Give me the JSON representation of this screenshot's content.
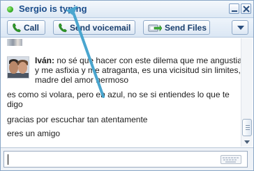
{
  "window": {
    "title": "Sergio is typing",
    "status_color": "#2aa51b",
    "minimize_icon": "minimize-icon",
    "close_icon": "close-icon"
  },
  "toolbar": {
    "call_label": "Call",
    "voicemail_label": "Send voicemail",
    "sendfiles_label": "Send Files",
    "call_icon": "phone-icon",
    "voicemail_icon": "phone-icon",
    "sendfiles_icon": "file-transfer-icon",
    "more_icon": "chevron-down-icon"
  },
  "chat": {
    "messages": [
      {
        "sender": "Iván:",
        "text": "no sé que hacer con este dilema que me angustia y me asfixia y me atraganta, es una vicisitud sin limites, madre del amor hermoso"
      },
      {
        "sender": "",
        "text": "es como si volara, pero en azul, no se si entiendes lo que te digo"
      },
      {
        "sender": "",
        "text": "gracias por escuchar tan atentamente"
      },
      {
        "sender": "",
        "text": "eres un amigo"
      }
    ]
  },
  "input": {
    "value": "",
    "keyboard_icon": "keyboard-icon"
  },
  "colors": {
    "title_text": "#1a4c8a",
    "annotation_arrow": "#4aa6cf"
  }
}
